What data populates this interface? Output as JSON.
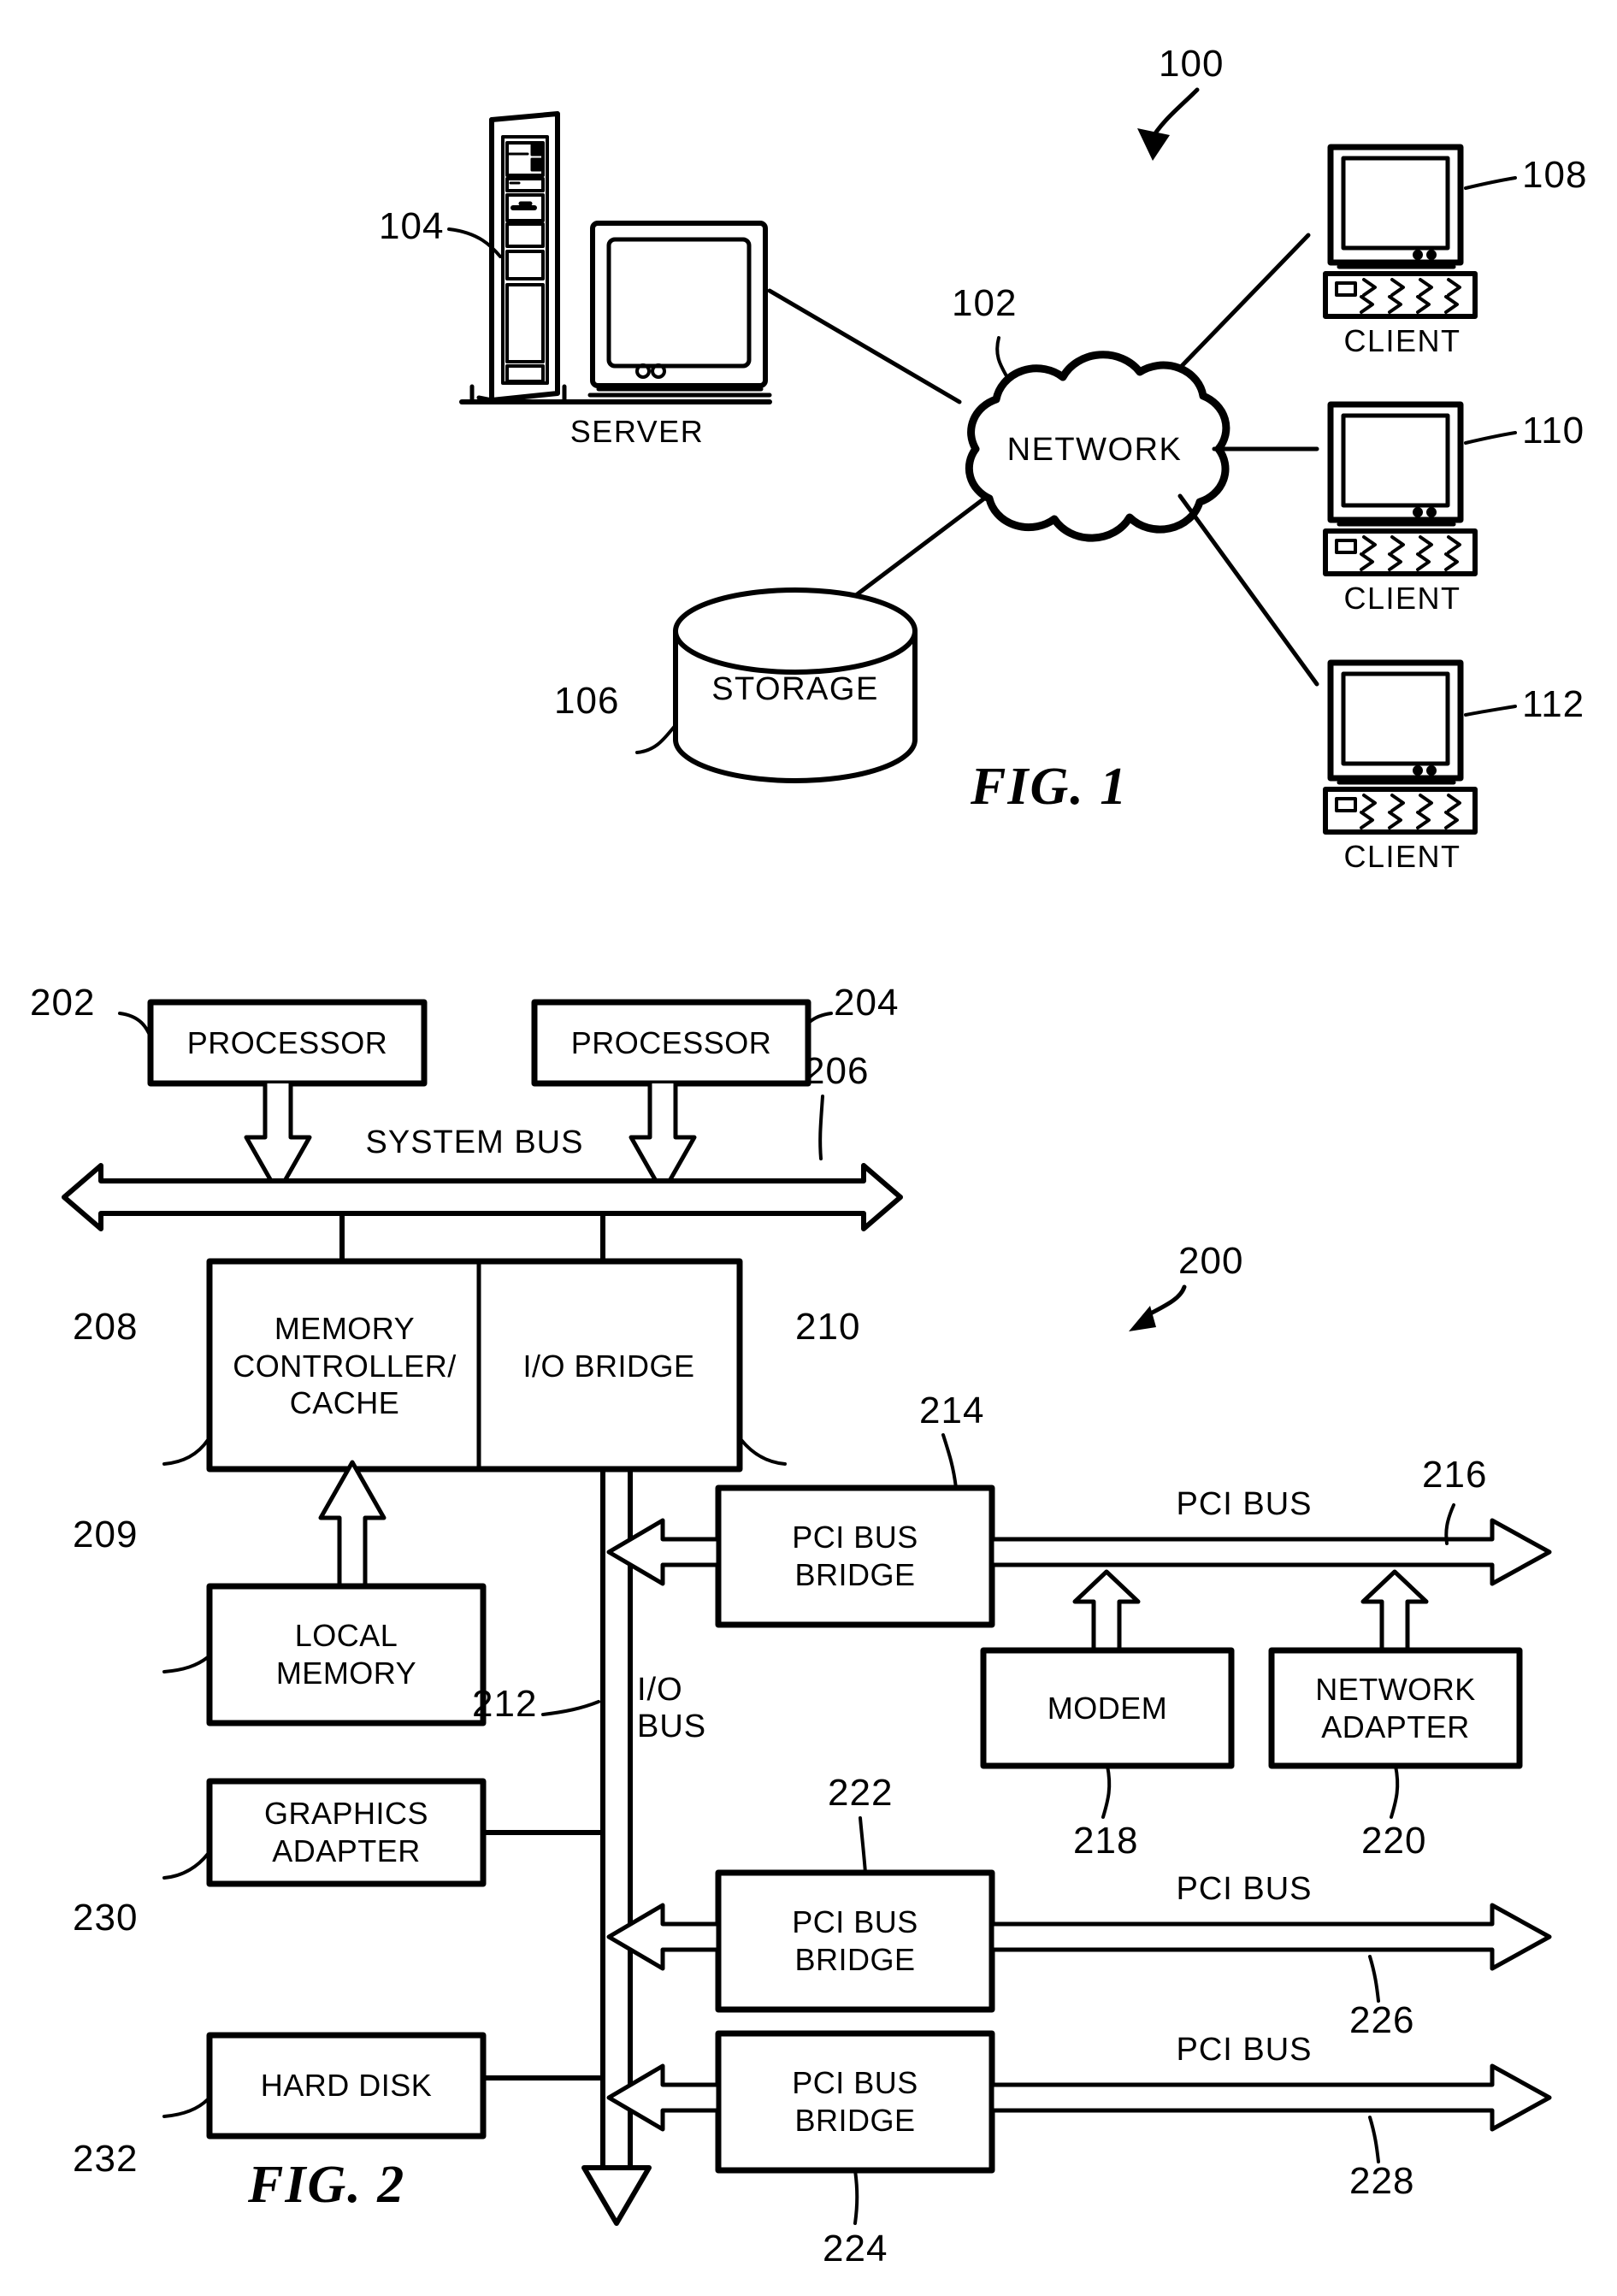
{
  "figures": [
    {
      "id": "fig1",
      "title": "FIG. 1",
      "system_ref": "100",
      "nodes": [
        {
          "name": "server",
          "label": "SERVER",
          "ref": "104"
        },
        {
          "name": "network",
          "label": "NETWORK",
          "ref": "102"
        },
        {
          "name": "storage",
          "label": "STORAGE",
          "ref": "106"
        },
        {
          "name": "client1",
          "label": "CLIENT",
          "ref": "108"
        },
        {
          "name": "client2",
          "label": "CLIENT",
          "ref": "110"
        },
        {
          "name": "client3",
          "label": "CLIENT",
          "ref": "112"
        }
      ]
    },
    {
      "id": "fig2",
      "title": "FIG. 2",
      "system_ref": "200",
      "blocks": [
        {
          "name": "processor-1",
          "label": "PROCESSOR",
          "ref": "202"
        },
        {
          "name": "processor-2",
          "label": "PROCESSOR",
          "ref": "204"
        },
        {
          "name": "memory-controller",
          "label": "MEMORY\nCONTROLLER/\nCACHE",
          "ref": "208"
        },
        {
          "name": "io-bridge",
          "label": "I/O BRIDGE",
          "ref": "210"
        },
        {
          "name": "local-memory",
          "label": "LOCAL\nMEMORY",
          "ref": "209"
        },
        {
          "name": "pci-bus-bridge-1",
          "label": "PCI BUS\nBRIDGE",
          "ref": "214"
        },
        {
          "name": "modem",
          "label": "MODEM",
          "ref": "218"
        },
        {
          "name": "network-adapter",
          "label": "NETWORK\nADAPTER",
          "ref": "220"
        },
        {
          "name": "graphics-adapter",
          "label": "GRAPHICS\nADAPTER",
          "ref": "230"
        },
        {
          "name": "pci-bus-bridge-2",
          "label": "PCI BUS\nBRIDGE",
          "ref": "222"
        },
        {
          "name": "hard-disk",
          "label": "HARD DISK",
          "ref": "232"
        },
        {
          "name": "pci-bus-bridge-3",
          "label": "PCI BUS\nBRIDGE",
          "ref": "224"
        }
      ],
      "buses": [
        {
          "name": "system-bus",
          "label": "SYSTEM BUS",
          "ref": "206"
        },
        {
          "name": "io-bus",
          "label": "I/O\nBUS",
          "ref": "212"
        },
        {
          "name": "pci-bus-1",
          "label": "PCI BUS",
          "ref": "216"
        },
        {
          "name": "pci-bus-2",
          "label": "PCI BUS",
          "ref": "226"
        },
        {
          "name": "pci-bus-3",
          "label": "PCI BUS",
          "ref": "228"
        }
      ]
    }
  ],
  "fig1": {
    "title": "FIG. 1",
    "ref_100": "100",
    "ref_102": "102",
    "ref_104": "104",
    "ref_106": "106",
    "ref_108": "108",
    "ref_110": "110",
    "ref_112": "112",
    "label_server": "SERVER",
    "label_network": "NETWORK",
    "label_storage": "STORAGE",
    "label_client1": "CLIENT",
    "label_client2": "CLIENT",
    "label_client3": "CLIENT"
  },
  "fig2": {
    "title": "FIG. 2",
    "ref_200": "200",
    "ref_202": "202",
    "ref_204": "204",
    "ref_206": "206",
    "ref_208": "208",
    "ref_209": "209",
    "ref_210": "210",
    "ref_212": "212",
    "ref_214": "214",
    "ref_216": "216",
    "ref_218": "218",
    "ref_220": "220",
    "ref_222": "222",
    "ref_224": "224",
    "ref_226": "226",
    "ref_228": "228",
    "ref_230": "230",
    "ref_232": "232",
    "label_processor1": "PROCESSOR",
    "label_processor2": "PROCESSOR",
    "label_system_bus": "SYSTEM BUS",
    "label_memory_controller_l1": "MEMORY",
    "label_memory_controller_l2": "CONTROLLER/",
    "label_memory_controller_l3": "CACHE",
    "label_io_bridge": "I/O BRIDGE",
    "label_local_memory_l1": "LOCAL",
    "label_local_memory_l2": "MEMORY",
    "label_io_bus_l1": "I/O",
    "label_io_bus_l2": "BUS",
    "label_pci_bridge1_l1": "PCI BUS",
    "label_pci_bridge1_l2": "BRIDGE",
    "label_pci_bus1": "PCI BUS",
    "label_modem": "MODEM",
    "label_network_adapter_l1": "NETWORK",
    "label_network_adapter_l2": "ADAPTER",
    "label_graphics_adapter_l1": "GRAPHICS",
    "label_graphics_adapter_l2": "ADAPTER",
    "label_pci_bridge2_l1": "PCI BUS",
    "label_pci_bridge2_l2": "BRIDGE",
    "label_pci_bus2": "PCI BUS",
    "label_hard_disk": "HARD DISK",
    "label_pci_bridge3_l1": "PCI BUS",
    "label_pci_bridge3_l2": "BRIDGE",
    "label_pci_bus3": "PCI BUS"
  },
  "colors": {
    "ink": "#000000",
    "paper": "#ffffff"
  }
}
